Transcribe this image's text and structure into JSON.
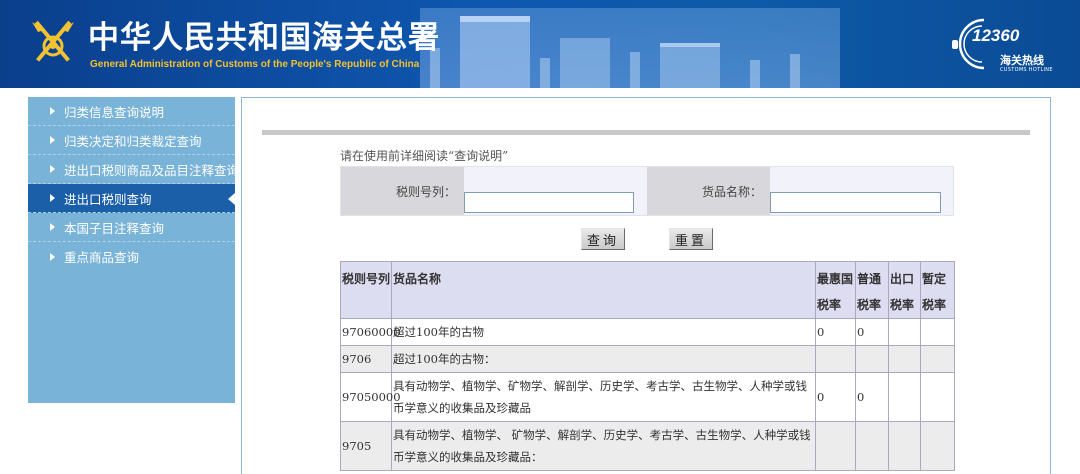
{
  "header": {
    "title_cn": "中华人民共和国海关总署",
    "title_en": "General Administration of Customs of the People's Republic of China",
    "hotline_number": "12360",
    "hotline_cn": "海关热线",
    "hotline_en": "CUSTOMS HOTLINE"
  },
  "sidebar": {
    "items": [
      {
        "label": "归类信息查询说明",
        "active": false
      },
      {
        "label": "归类决定和归类裁定查询",
        "active": false
      },
      {
        "label": "进出口税则商品及品目注释查询",
        "active": false
      },
      {
        "label": "进出口税则查询",
        "active": true
      },
      {
        "label": "本国子目注释查询",
        "active": false
      },
      {
        "label": "重点商品查询",
        "active": false
      }
    ]
  },
  "main": {
    "instruction": "请在使用前详细阅读“查询说明”",
    "search": {
      "code_label": "税则号列：",
      "code_value": "",
      "name_label": "货品名称：",
      "name_value": ""
    },
    "buttons": {
      "query": "查询",
      "reset": "重置"
    },
    "table": {
      "headers": {
        "code": "税则号列",
        "name": "货品名称",
        "mfn_1": "最惠国",
        "mfn_2": "税率",
        "general_1": "普通",
        "general_2": "税率",
        "export_1": "出口",
        "export_2": "税率",
        "provisional_1": "暂定",
        "provisional_2": "税率"
      },
      "rows": [
        {
          "code": "97060000",
          "name": "超过100年的古物",
          "mfn": "0",
          "general": "0",
          "export": "",
          "provisional": ""
        },
        {
          "code": "9706",
          "name": "超过100年的古物：",
          "mfn": "",
          "general": "",
          "export": "",
          "provisional": ""
        },
        {
          "code": "97050000",
          "name": "具有动物学、植物学、矿物学、解剖学、历史学、考古学、古生物学、人种学或钱币学意义的收集品及珍藏品",
          "mfn": "0",
          "general": "0",
          "export": "",
          "provisional": ""
        },
        {
          "code": "9705",
          "name": "具有动物学、植物学、 矿物学、解剖学、历史学、考古学、古生物学、人种学或钱币学意义的收集品及珍藏品：",
          "mfn": "",
          "general": "",
          "export": "",
          "provisional": ""
        }
      ]
    }
  }
}
